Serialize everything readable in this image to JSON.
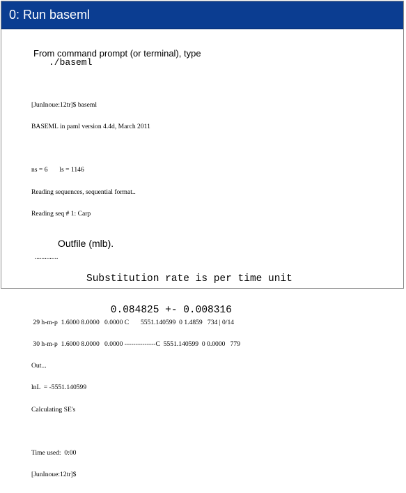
{
  "slide": {
    "title": "0: Run baseml",
    "intro": "From command prompt (or terminal), type",
    "command": "./baseml",
    "terminal_lines": [
      "[JunInoue:12tr]$ baseml",
      "BASEML in paml version 4.4d, March 2011",
      "",
      "ns = 6       ls = 1146",
      "Reading sequences, sequential format..",
      "Reading seq # 1: Carp",
      "",
      "  ..............",
      "",
      "",
      " 29 h-m-p  1.6000 8.0000   0.0000 C       5551.140599  0 1.4859   734 | 0/14",
      " 30 h-m-p  1.6000 8.0000   0.0000 --------------C  5551.140599  0 0.0000   779",
      "Out...",
      "lnL  = -5551.140599",
      "Calculating SE's",
      "",
      "Time used:  0:00",
      "[JunInoue:12tr]$"
    ],
    "outfile_label": "Outfile (mlb).",
    "result_lines": [
      "Substitution rate is per time unit",
      "    0.084825 +- 0.008316"
    ]
  },
  "colors": {
    "title_bar": "#0b3d91",
    "title_text": "#ffffff",
    "frame_border": "#8a8a8a"
  }
}
